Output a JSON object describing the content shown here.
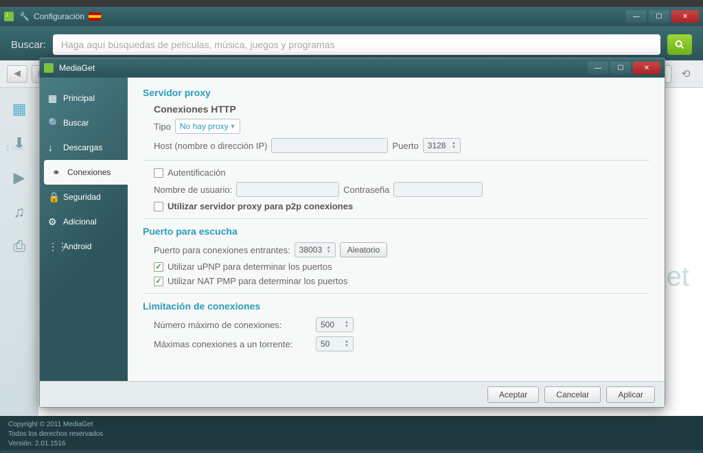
{
  "main_window": {
    "title": "Configuración",
    "search_label": "Buscar:",
    "search_placeholder": "Haga aquí búsquedas de películas, música, juegos y programas",
    "status": "1 nue",
    "ghost": "et",
    "footer": {
      "copyright": "Copyright © 2011 MediaGet",
      "rights": "Todos los derechos reservados",
      "version": "Versión: 2.01.1516"
    }
  },
  "dialog": {
    "title": "MediaGet",
    "sidebar": [
      {
        "icon": "grid",
        "label": "Principal"
      },
      {
        "icon": "search",
        "label": "Buscar"
      },
      {
        "icon": "download",
        "label": "Descargas"
      },
      {
        "icon": "link",
        "label": "Conexiones"
      },
      {
        "icon": "lock",
        "label": "Seguridad"
      },
      {
        "icon": "gear",
        "label": "Adicional"
      },
      {
        "icon": "android",
        "label": "Android"
      }
    ],
    "proxy": {
      "section": "Servidor proxy",
      "http_title": "Conexiones HTTP",
      "type_label": "Tipo",
      "type_value": "No hay proxy",
      "host_label": "Host (nombre o dirección IP)",
      "host_value": "",
      "port_label": "Puerto",
      "port_value": "3128",
      "auth_label": "Autentificación",
      "user_label": "Nombre de usuario:",
      "user_value": "",
      "pass_label": "Contraseña",
      "pass_value": "",
      "p2p_label": "Utilizar servidor proxy para p2p conexiones"
    },
    "listen": {
      "section": "Puerto para escucha",
      "port_label": "Puerto para conexiones entrantes:",
      "port_value": "38003",
      "random_btn": "Aleatorio",
      "upnp_label": "Utilizar uPNP para determinar los puertos",
      "natpmp_label": "Utilizar NAT PMP para determinar los puertos"
    },
    "limit": {
      "section": "Limitación de conexiones",
      "max_conn_label": "Número máximo de conexiones:",
      "max_conn_value": "500",
      "max_torrent_label": "Máximas conexiones a un torrente:",
      "max_torrent_value": "50"
    },
    "buttons": {
      "accept": "Aceptar",
      "cancel": "Cancelar",
      "apply": "Aplicar"
    }
  }
}
